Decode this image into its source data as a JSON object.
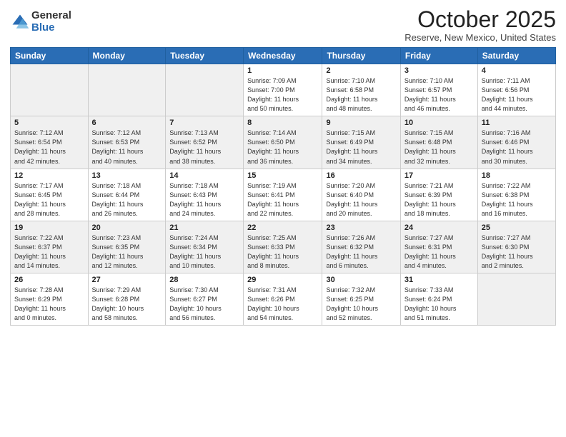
{
  "logo": {
    "general": "General",
    "blue": "Blue"
  },
  "title": "October 2025",
  "location": "Reserve, New Mexico, United States",
  "days_header": [
    "Sunday",
    "Monday",
    "Tuesday",
    "Wednesday",
    "Thursday",
    "Friday",
    "Saturday"
  ],
  "weeks": [
    [
      {
        "day": "",
        "info": ""
      },
      {
        "day": "",
        "info": ""
      },
      {
        "day": "",
        "info": ""
      },
      {
        "day": "1",
        "info": "Sunrise: 7:09 AM\nSunset: 7:00 PM\nDaylight: 11 hours\nand 50 minutes."
      },
      {
        "day": "2",
        "info": "Sunrise: 7:10 AM\nSunset: 6:58 PM\nDaylight: 11 hours\nand 48 minutes."
      },
      {
        "day": "3",
        "info": "Sunrise: 7:10 AM\nSunset: 6:57 PM\nDaylight: 11 hours\nand 46 minutes."
      },
      {
        "day": "4",
        "info": "Sunrise: 7:11 AM\nSunset: 6:56 PM\nDaylight: 11 hours\nand 44 minutes."
      }
    ],
    [
      {
        "day": "5",
        "info": "Sunrise: 7:12 AM\nSunset: 6:54 PM\nDaylight: 11 hours\nand 42 minutes."
      },
      {
        "day": "6",
        "info": "Sunrise: 7:12 AM\nSunset: 6:53 PM\nDaylight: 11 hours\nand 40 minutes."
      },
      {
        "day": "7",
        "info": "Sunrise: 7:13 AM\nSunset: 6:52 PM\nDaylight: 11 hours\nand 38 minutes."
      },
      {
        "day": "8",
        "info": "Sunrise: 7:14 AM\nSunset: 6:50 PM\nDaylight: 11 hours\nand 36 minutes."
      },
      {
        "day": "9",
        "info": "Sunrise: 7:15 AM\nSunset: 6:49 PM\nDaylight: 11 hours\nand 34 minutes."
      },
      {
        "day": "10",
        "info": "Sunrise: 7:15 AM\nSunset: 6:48 PM\nDaylight: 11 hours\nand 32 minutes."
      },
      {
        "day": "11",
        "info": "Sunrise: 7:16 AM\nSunset: 6:46 PM\nDaylight: 11 hours\nand 30 minutes."
      }
    ],
    [
      {
        "day": "12",
        "info": "Sunrise: 7:17 AM\nSunset: 6:45 PM\nDaylight: 11 hours\nand 28 minutes."
      },
      {
        "day": "13",
        "info": "Sunrise: 7:18 AM\nSunset: 6:44 PM\nDaylight: 11 hours\nand 26 minutes."
      },
      {
        "day": "14",
        "info": "Sunrise: 7:18 AM\nSunset: 6:43 PM\nDaylight: 11 hours\nand 24 minutes."
      },
      {
        "day": "15",
        "info": "Sunrise: 7:19 AM\nSunset: 6:41 PM\nDaylight: 11 hours\nand 22 minutes."
      },
      {
        "day": "16",
        "info": "Sunrise: 7:20 AM\nSunset: 6:40 PM\nDaylight: 11 hours\nand 20 minutes."
      },
      {
        "day": "17",
        "info": "Sunrise: 7:21 AM\nSunset: 6:39 PM\nDaylight: 11 hours\nand 18 minutes."
      },
      {
        "day": "18",
        "info": "Sunrise: 7:22 AM\nSunset: 6:38 PM\nDaylight: 11 hours\nand 16 minutes."
      }
    ],
    [
      {
        "day": "19",
        "info": "Sunrise: 7:22 AM\nSunset: 6:37 PM\nDaylight: 11 hours\nand 14 minutes."
      },
      {
        "day": "20",
        "info": "Sunrise: 7:23 AM\nSunset: 6:35 PM\nDaylight: 11 hours\nand 12 minutes."
      },
      {
        "day": "21",
        "info": "Sunrise: 7:24 AM\nSunset: 6:34 PM\nDaylight: 11 hours\nand 10 minutes."
      },
      {
        "day": "22",
        "info": "Sunrise: 7:25 AM\nSunset: 6:33 PM\nDaylight: 11 hours\nand 8 minutes."
      },
      {
        "day": "23",
        "info": "Sunrise: 7:26 AM\nSunset: 6:32 PM\nDaylight: 11 hours\nand 6 minutes."
      },
      {
        "day": "24",
        "info": "Sunrise: 7:27 AM\nSunset: 6:31 PM\nDaylight: 11 hours\nand 4 minutes."
      },
      {
        "day": "25",
        "info": "Sunrise: 7:27 AM\nSunset: 6:30 PM\nDaylight: 11 hours\nand 2 minutes."
      }
    ],
    [
      {
        "day": "26",
        "info": "Sunrise: 7:28 AM\nSunset: 6:29 PM\nDaylight: 11 hours\nand 0 minutes."
      },
      {
        "day": "27",
        "info": "Sunrise: 7:29 AM\nSunset: 6:28 PM\nDaylight: 10 hours\nand 58 minutes."
      },
      {
        "day": "28",
        "info": "Sunrise: 7:30 AM\nSunset: 6:27 PM\nDaylight: 10 hours\nand 56 minutes."
      },
      {
        "day": "29",
        "info": "Sunrise: 7:31 AM\nSunset: 6:26 PM\nDaylight: 10 hours\nand 54 minutes."
      },
      {
        "day": "30",
        "info": "Sunrise: 7:32 AM\nSunset: 6:25 PM\nDaylight: 10 hours\nand 52 minutes."
      },
      {
        "day": "31",
        "info": "Sunrise: 7:33 AM\nSunset: 6:24 PM\nDaylight: 10 hours\nand 51 minutes."
      },
      {
        "day": "",
        "info": ""
      }
    ]
  ]
}
